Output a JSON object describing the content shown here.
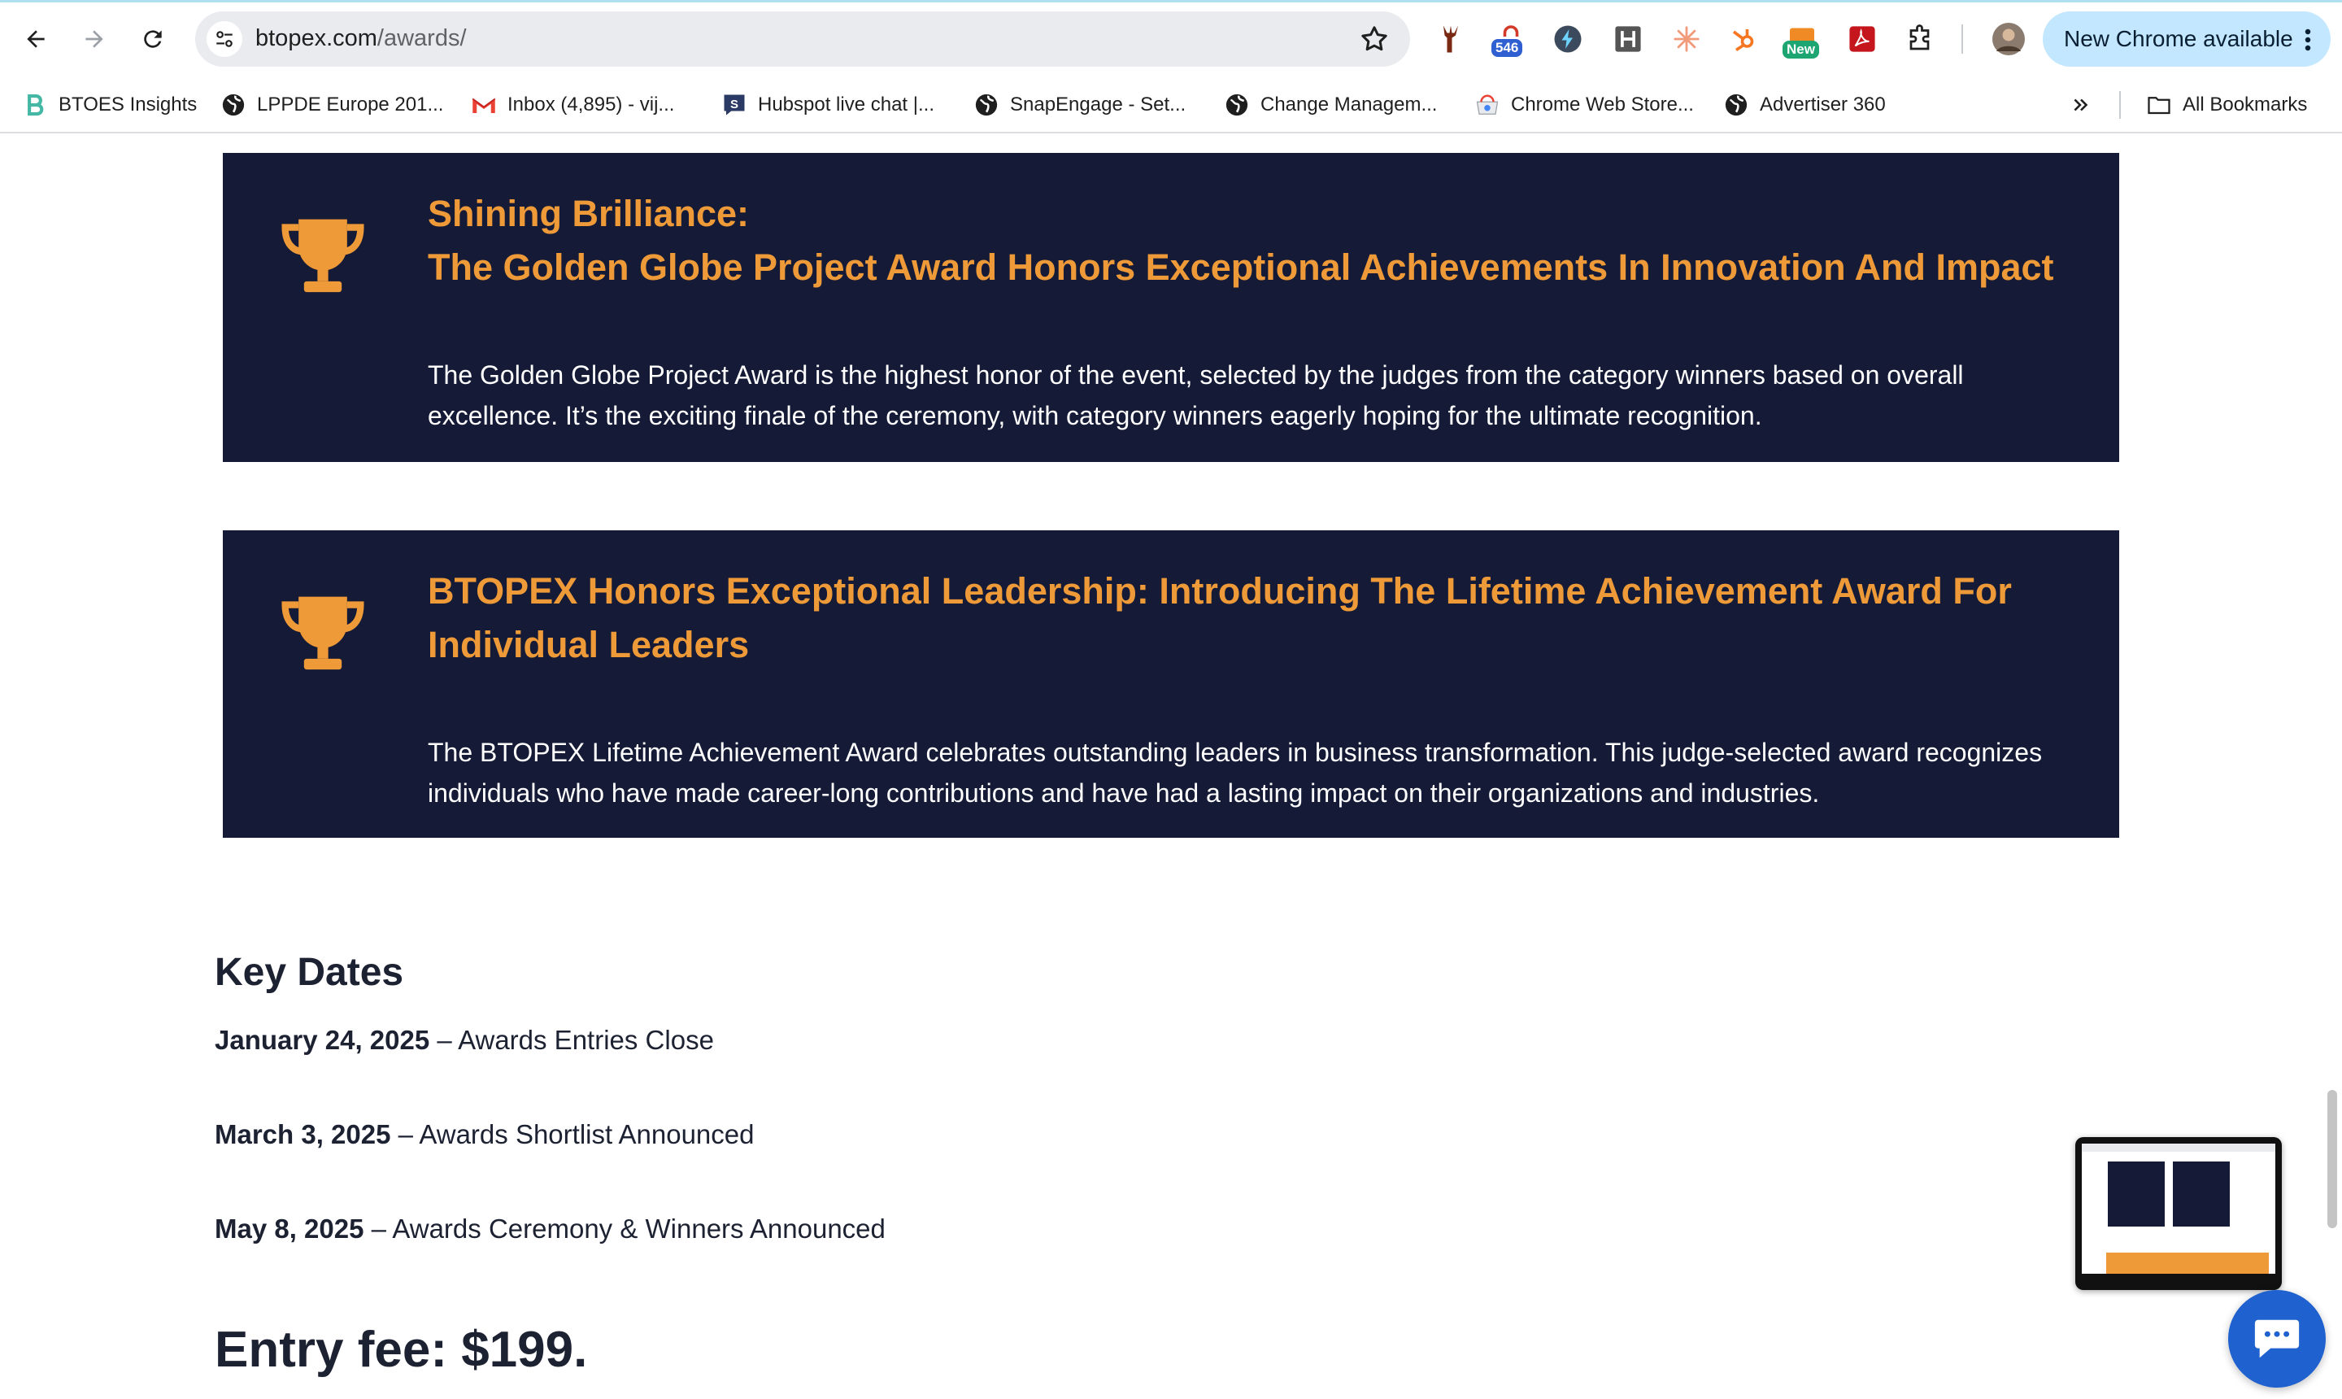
{
  "browser": {
    "url_host": "btopex.com",
    "url_path": "/awards/",
    "ext_badge_count": "546",
    "ext_new_badge": "New",
    "update_label": "New Chrome available",
    "bookmarks": [
      {
        "label": "BTOES Insights",
        "icon": "btoes-logo-icon"
      },
      {
        "label": "LPPDE Europe 201...",
        "icon": "globe-icon"
      },
      {
        "label": "Inbox (4,895) - vij...",
        "icon": "gmail-icon"
      },
      {
        "label": "Hubspot live chat |...",
        "icon": "snapengage-icon"
      },
      {
        "label": "SnapEngage - Set...",
        "icon": "globe-icon"
      },
      {
        "label": "Change Managem...",
        "icon": "globe-icon"
      },
      {
        "label": "Chrome Web Store...",
        "icon": "webstore-icon"
      },
      {
        "label": "Advertiser 360",
        "icon": "globe-icon"
      }
    ],
    "all_bookmarks": "All Bookmarks"
  },
  "cards": [
    {
      "title_line1": "Shining Brilliance:",
      "title_line2": "The Golden Globe Project Award Honors Exceptional Achievements In Innovation And Impact",
      "text": "The Golden Globe Project Award is the highest honor of the event, selected by the judges from the category winners based on overall excellence. It’s the exciting finale of the ceremony, with category winners eagerly hoping for the ultimate recognition."
    },
    {
      "title_line1": "BTOPEX Honors Exceptional Leadership: Introducing The Lifetime Achievement Award For Individual Leaders",
      "text": "The BTOPEX Lifetime Achievement Award celebrates outstanding leaders in business transformation. This judge-selected award recognizes individuals who have made career-long contributions and have had a lasting impact on their organizations and industries."
    }
  ],
  "key_dates": {
    "title": "Key Dates",
    "rows": [
      {
        "date": "January 24, 2025",
        "event": " – Awards Entries Close"
      },
      {
        "date": "March 3, 2025",
        "event": " – Awards Shortlist Announced"
      },
      {
        "date": "May 8, 2025",
        "event": " – Awards Ceremony & Winners Announced"
      }
    ]
  },
  "entry_fee": "Entry fee: $199.",
  "colors": {
    "card_bg": "#151b36",
    "accent_orange": "#ef9a38",
    "text_dark": "#1d2233",
    "chat_blue": "#1f62cf"
  }
}
